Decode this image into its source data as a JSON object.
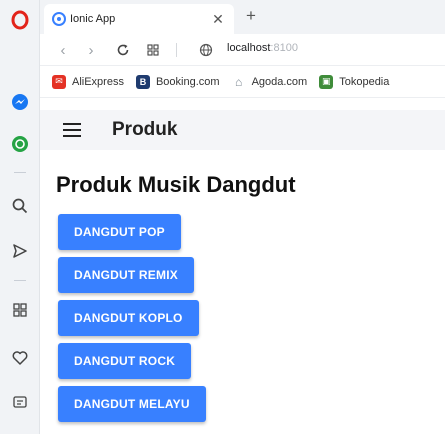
{
  "browser": {
    "tab": {
      "title": "Ionic App"
    },
    "url": {
      "host": "localhost",
      "port": ":8100"
    },
    "bookmarks": [
      {
        "label": "AliExpress",
        "icon": "aliexpress-icon",
        "color": "#e43225"
      },
      {
        "label": "Booking.com",
        "icon": "booking-icon",
        "color": "#1f3b6f"
      },
      {
        "label": "Agoda.com",
        "icon": "agoda-icon",
        "color": "#7d8893"
      },
      {
        "label": "Tokopedia",
        "icon": "tokopedia-icon",
        "color": "#3f8c3a"
      }
    ]
  },
  "app": {
    "toolbar_title": "Produk",
    "heading": "Produk Musik Dangdut",
    "buttons": [
      "DANGDUT POP",
      "DANGDUT REMIX",
      "DANGDUT KOPLO",
      "DANGDUT ROCK",
      "DANGDUT MELAYU"
    ],
    "accent_color": "#3880ff"
  }
}
